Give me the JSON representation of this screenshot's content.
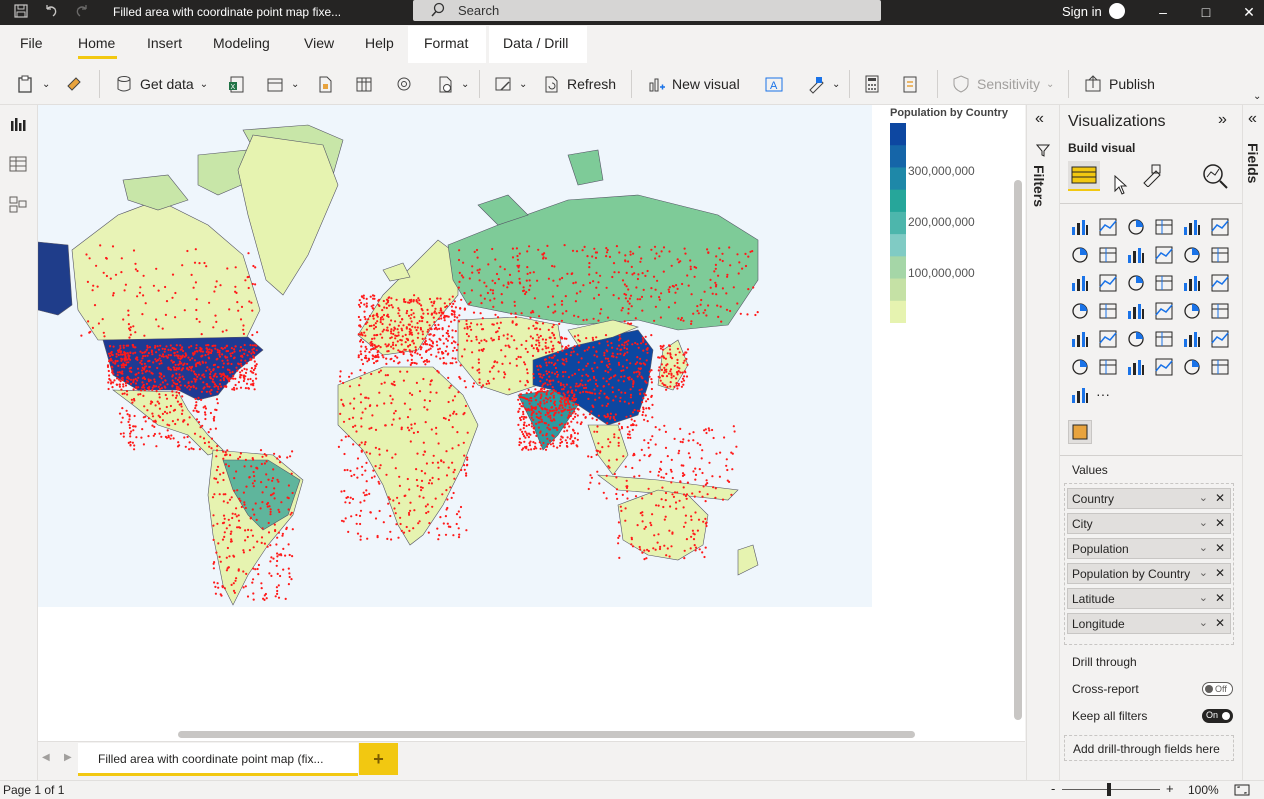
{
  "titlebar": {
    "doc_title": "Filled area with coordinate point map fixe...",
    "search_placeholder": "Search",
    "signin": "Sign in"
  },
  "menu": {
    "file": "File",
    "home": "Home",
    "insert": "Insert",
    "modeling": "Modeling",
    "view": "View",
    "help": "Help",
    "format": "Format",
    "data_drill": "Data / Drill"
  },
  "ribbon": {
    "get_data": "Get data",
    "refresh": "Refresh",
    "new_visual": "New visual",
    "sensitivity": "Sensitivity",
    "publish": "Publish"
  },
  "legend": {
    "title": "Population by Country",
    "ticks": [
      "300,000,000",
      "200,000,000",
      "100,000,000"
    ],
    "colors": [
      "#0d47a1",
      "#1565a8",
      "#1e88a8",
      "#26a69a",
      "#4db6ac",
      "#80cbc4",
      "#a5d6a7",
      "#c5e1a5",
      "#e6f3b0"
    ]
  },
  "filters": {
    "label": "Filters"
  },
  "visualizations": {
    "title": "Visualizations",
    "build_visual": "Build visual",
    "values_label": "Values",
    "wells": [
      "Country",
      "City",
      "Population",
      "Population by Country",
      "Latitude",
      "Longitude"
    ],
    "drill_through": "Drill through",
    "cross_report": "Cross-report",
    "cross_report_state": "Off",
    "keep_all_filters": "Keep all filters",
    "keep_all_filters_state": "On",
    "add_drill": "Add drill-through fields here",
    "more": "···"
  },
  "fields": {
    "label": "Fields"
  },
  "pages": {
    "tab": "Filled area with coordinate point map (fix...",
    "add": "+"
  },
  "status": {
    "page": "Page 1 of 1",
    "zoom": "100%",
    "minus": "-",
    "plus": "+"
  }
}
